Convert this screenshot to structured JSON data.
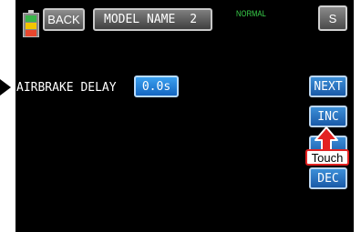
{
  "header": {
    "back_label": "BACK",
    "model_name": "MODEL NAME",
    "model_number": "2",
    "mode": "NORMAL",
    "s_label": "S"
  },
  "parameter": {
    "label": "AIRBRAKE DELAY",
    "value": "0.0s"
  },
  "side_buttons": {
    "next": "NEXT",
    "inc": "INC",
    "dec": "DEC"
  },
  "annotation": {
    "touch": "Touch"
  },
  "colors": {
    "screen_bg": "#000000",
    "value_blue": "#2a80d8",
    "mode_green": "#39d14b",
    "touch_border": "#e32222",
    "arrow_red": "#e32222"
  },
  "icons": [
    "battery-icon",
    "pointer-arrow-icon",
    "touch-arrow-icon"
  ]
}
